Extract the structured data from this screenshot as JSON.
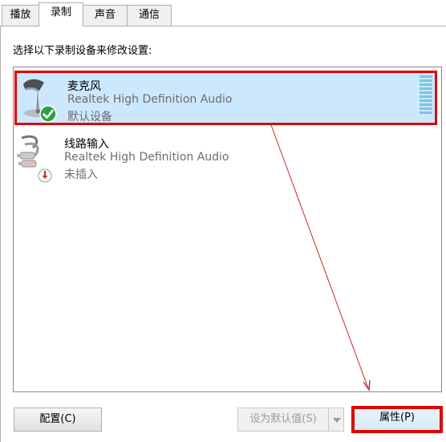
{
  "tabs": [
    {
      "label": "播放"
    },
    {
      "label": "录制"
    },
    {
      "label": "声音"
    },
    {
      "label": "通信"
    }
  ],
  "active_tab": "录制",
  "instruction": "选择以下录制设备来修改设置:",
  "devices": [
    {
      "name": "麦克风",
      "driver": "Realtek High Definition Audio",
      "status": "默认设备",
      "icon": "microphone-icon",
      "selected": true
    },
    {
      "name": "线路输入",
      "driver": "Realtek High Definition Audio",
      "status": "未插入",
      "icon": "line-in-icon",
      "selected": false
    }
  ],
  "buttons": {
    "configure": "配置(C)",
    "set_default": "设为默认值(S)",
    "properties": "属性(P)"
  },
  "colors": {
    "selection": "#cce8ff",
    "highlight": "#e00000",
    "level_meter": "#7ec3e6"
  }
}
